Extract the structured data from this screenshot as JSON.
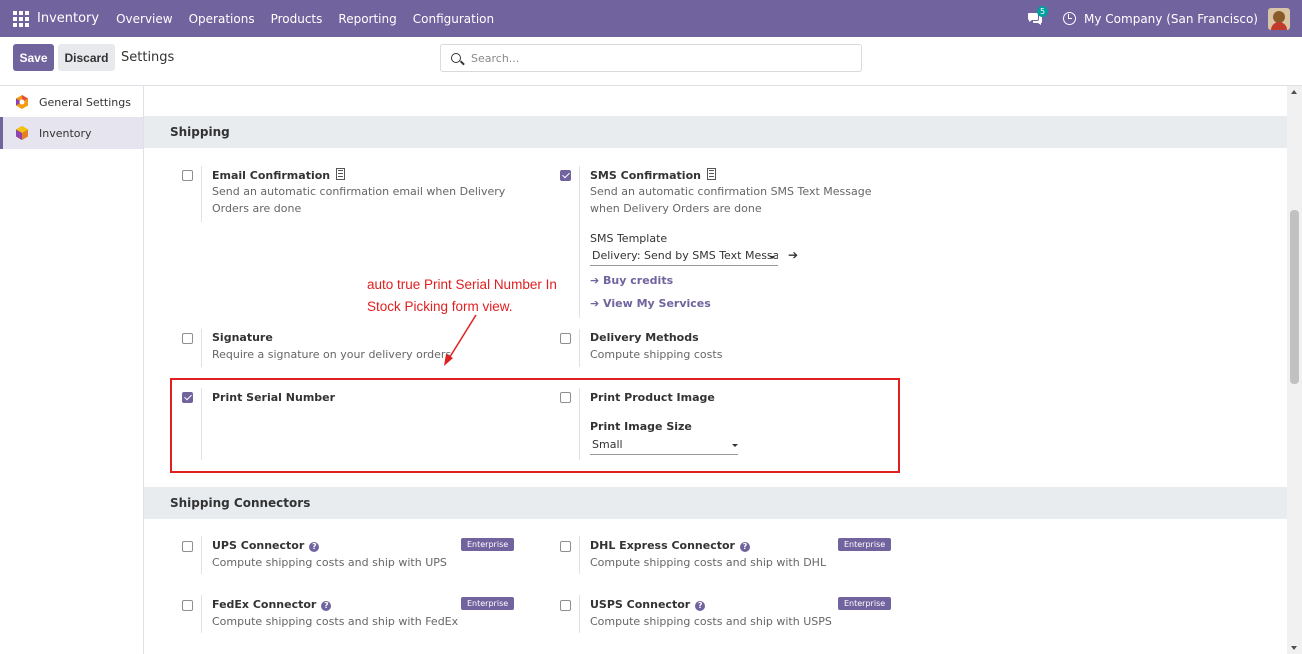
{
  "navbar": {
    "brand": "Inventory",
    "menu": [
      "Overview",
      "Operations",
      "Products",
      "Reporting",
      "Configuration"
    ],
    "chat_count": "5",
    "company": "My Company (San Francisco)"
  },
  "control": {
    "save_label": "Save",
    "discard_label": "Discard",
    "title": "Settings",
    "search_placeholder": "Search..."
  },
  "sidebar": {
    "items": [
      {
        "label": "General Settings",
        "icon": "odoo-logo-icon"
      },
      {
        "label": "Inventory",
        "icon": "inventory-app-icon"
      }
    ]
  },
  "shipping": {
    "title": "Shipping",
    "email": {
      "title": "Email Confirmation",
      "desc": "Send an automatic confirmation email when Delivery Orders are done",
      "checked": false
    },
    "sms": {
      "title": "SMS Confirmation",
      "desc": "Send an automatic confirmation SMS Text Message when Delivery Orders are done",
      "checked": true,
      "template_label": "SMS Template",
      "template_value": "Delivery: Send by SMS Text Message",
      "buy_credits": "Buy credits",
      "view_services": "View My Services"
    },
    "signature": {
      "title": "Signature",
      "desc": "Require a signature on your delivery orders",
      "checked": false
    },
    "delivery": {
      "title": "Delivery Methods",
      "desc": "Compute shipping costs",
      "checked": false
    },
    "print_serial": {
      "title": "Print Serial Number",
      "checked": true
    },
    "print_image": {
      "title": "Print Product Image",
      "checked": false,
      "size_label": "Print Image Size",
      "size_value": "Small"
    }
  },
  "annotation": {
    "line1": "auto true Print Serial Number In",
    "line2": "Stock Picking form view.",
    "color": "#e02020"
  },
  "connectors": {
    "title": "Shipping Connectors",
    "badge": "Enterprise",
    "ups": {
      "title": "UPS Connector",
      "desc": "Compute shipping costs and ship with UPS"
    },
    "dhl": {
      "title": "DHL Express Connector",
      "desc": "Compute shipping costs and ship with DHL"
    },
    "fedex": {
      "title": "FedEx Connector",
      "desc": "Compute shipping costs and ship with FedEx"
    },
    "usps": {
      "title": "USPS Connector",
      "desc": "Compute shipping costs and ship with USPS"
    }
  },
  "colors": {
    "brand": "#71639e",
    "annotation": "#e02020"
  }
}
